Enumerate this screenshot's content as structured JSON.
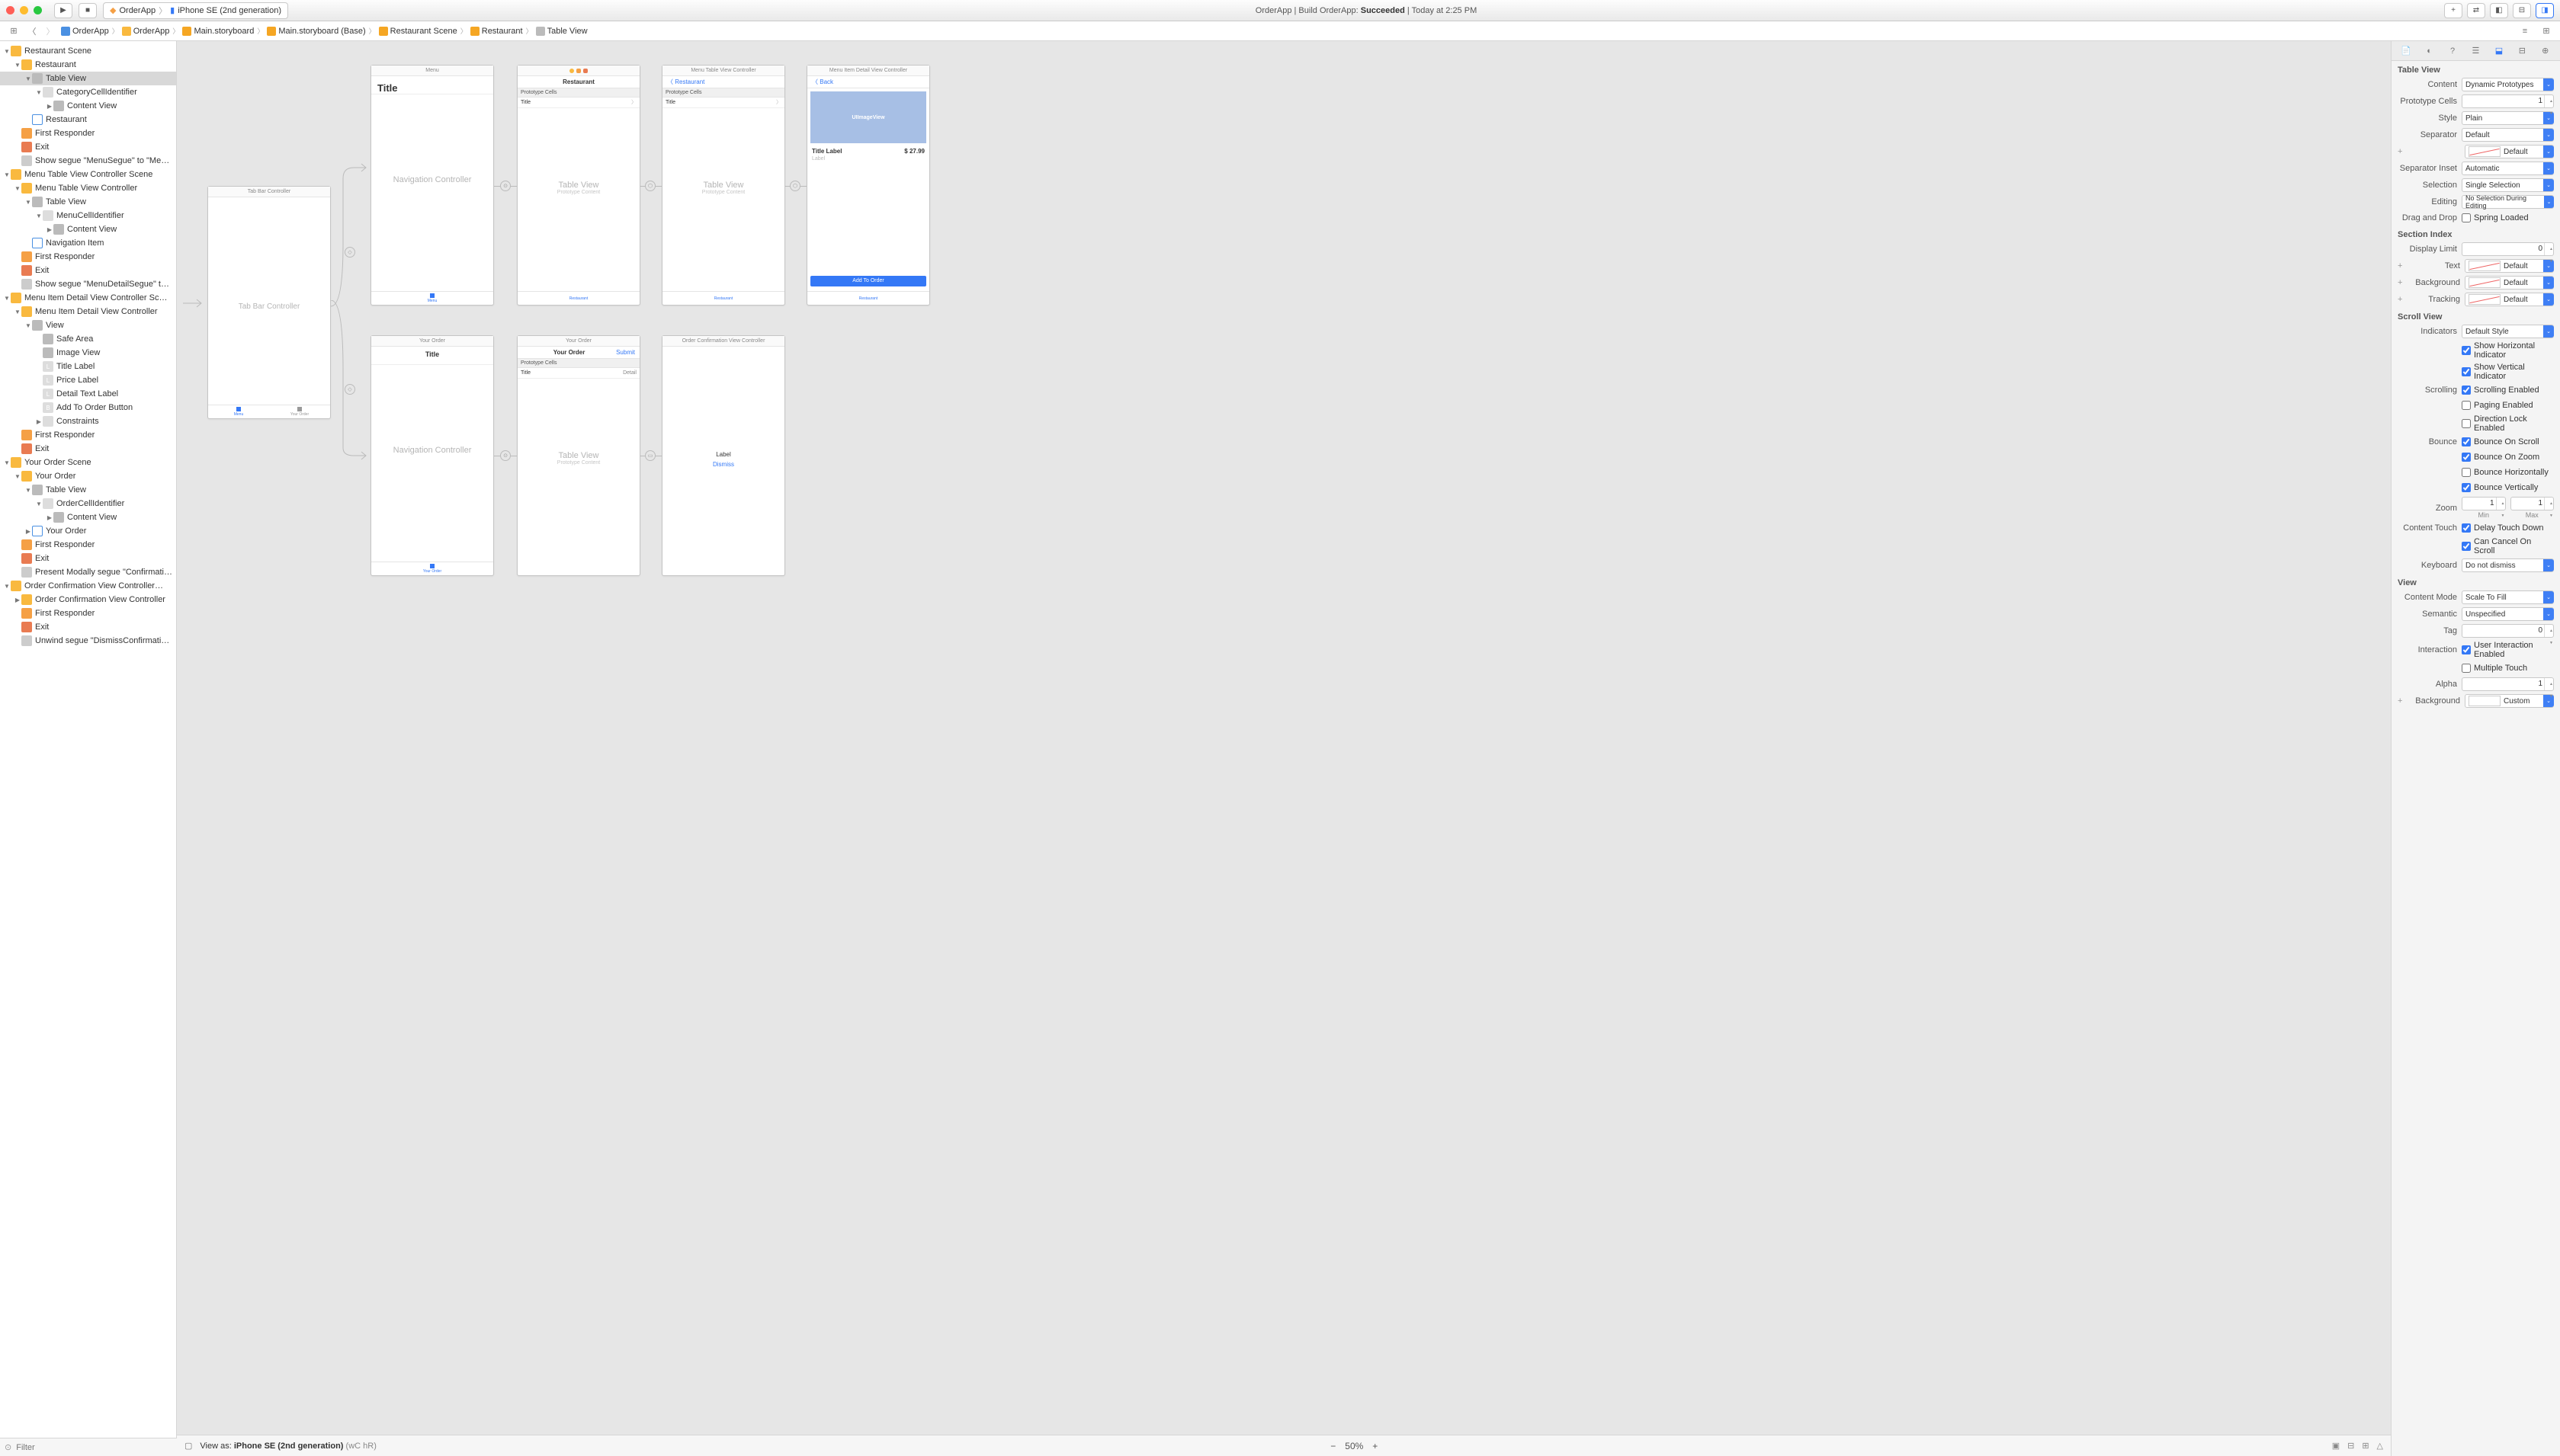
{
  "toolbar": {
    "scheme": "OrderApp",
    "device": "iPhone SE (2nd generation)",
    "status_prefix": "OrderApp | Build OrderApp:",
    "status_result": "Succeeded",
    "status_time": "Today at 2:25 PM"
  },
  "breadcrumb": [
    "OrderApp",
    "OrderApp",
    "Main.storyboard",
    "Main.storyboard (Base)",
    "Restaurant Scene",
    "Restaurant",
    "Table View"
  ],
  "outline": {
    "filter_placeholder": "Filter",
    "nodes": [
      {
        "d": 0,
        "t": "scene",
        "label": "Restaurant Scene",
        "open": true
      },
      {
        "d": 1,
        "t": "vc",
        "label": "Restaurant",
        "open": true
      },
      {
        "d": 2,
        "t": "view",
        "label": "Table View",
        "open": true,
        "sel": true
      },
      {
        "d": 3,
        "t": "cell",
        "label": "CategoryCellIdentifier",
        "open": true
      },
      {
        "d": 4,
        "t": "view",
        "label": "Content View",
        "open": false
      },
      {
        "d": 2,
        "t": "nav",
        "label": "Restaurant"
      },
      {
        "d": 1,
        "t": "fr",
        "label": "First Responder"
      },
      {
        "d": 1,
        "t": "exit",
        "label": "Exit"
      },
      {
        "d": 1,
        "t": "segue",
        "label": "Show segue \"MenuSegue\" to \"Me…"
      },
      {
        "d": 0,
        "t": "scene",
        "label": "Menu Table View Controller Scene",
        "open": true
      },
      {
        "d": 1,
        "t": "vc",
        "label": "Menu Table View Controller",
        "open": true
      },
      {
        "d": 2,
        "t": "view",
        "label": "Table View",
        "open": true
      },
      {
        "d": 3,
        "t": "cell",
        "label": "MenuCellIdentifier",
        "open": true
      },
      {
        "d": 4,
        "t": "view",
        "label": "Content View",
        "open": false
      },
      {
        "d": 2,
        "t": "nav",
        "label": "Navigation Item"
      },
      {
        "d": 1,
        "t": "fr",
        "label": "First Responder"
      },
      {
        "d": 1,
        "t": "exit",
        "label": "Exit"
      },
      {
        "d": 1,
        "t": "segue",
        "label": "Show segue \"MenuDetailSegue\" t…"
      },
      {
        "d": 0,
        "t": "scene",
        "label": "Menu Item Detail View Controller Sc…",
        "open": true
      },
      {
        "d": 1,
        "t": "vc",
        "label": "Menu Item Detail View Controller",
        "open": true
      },
      {
        "d": 2,
        "t": "view",
        "label": "View",
        "open": true
      },
      {
        "d": 3,
        "t": "view",
        "label": "Safe Area"
      },
      {
        "d": 3,
        "t": "view",
        "label": "Image View"
      },
      {
        "d": 3,
        "t": "label",
        "label": "Title Label"
      },
      {
        "d": 3,
        "t": "label",
        "label": "Price Label"
      },
      {
        "d": 3,
        "t": "label",
        "label": "Detail Text Label"
      },
      {
        "d": 3,
        "t": "btn",
        "label": "Add To Order Button"
      },
      {
        "d": 3,
        "t": "cell",
        "label": "Constraints",
        "open": false
      },
      {
        "d": 1,
        "t": "fr",
        "label": "First Responder"
      },
      {
        "d": 1,
        "t": "exit",
        "label": "Exit"
      },
      {
        "d": 0,
        "t": "scene",
        "label": "Your Order Scene",
        "open": true
      },
      {
        "d": 1,
        "t": "vc",
        "label": "Your Order",
        "open": true
      },
      {
        "d": 2,
        "t": "view",
        "label": "Table View",
        "open": true
      },
      {
        "d": 3,
        "t": "cell",
        "label": "OrderCellIdentifier",
        "open": true
      },
      {
        "d": 4,
        "t": "view",
        "label": "Content View",
        "open": false
      },
      {
        "d": 2,
        "t": "nav",
        "label": "Your Order",
        "open": false
      },
      {
        "d": 1,
        "t": "fr",
        "label": "First Responder"
      },
      {
        "d": 1,
        "t": "exit",
        "label": "Exit"
      },
      {
        "d": 1,
        "t": "segue",
        "label": "Present Modally segue \"Confirmati…"
      },
      {
        "d": 0,
        "t": "scene",
        "label": "Order Confirmation View Controller…",
        "open": true
      },
      {
        "d": 1,
        "t": "vc",
        "label": "Order Confirmation View Controller",
        "open": false
      },
      {
        "d": 1,
        "t": "fr",
        "label": "First Responder"
      },
      {
        "d": 1,
        "t": "exit",
        "label": "Exit"
      },
      {
        "d": 1,
        "t": "segue",
        "label": "Unwind segue \"DismissConfirmati…"
      }
    ]
  },
  "canvas": {
    "view_as_prefix": "View as:",
    "view_as_device": "iPhone SE (2nd generation)",
    "view_as_suffix": "(wC hR)",
    "zoom": "50%",
    "scenes": {
      "tabbar": {
        "hdr": "Tab Bar Controller",
        "body": "Tab Bar Controller",
        "tabs": [
          {
            "label": "Menu",
            "on": true
          },
          {
            "label": "Your Order",
            "on": false
          }
        ]
      },
      "nav_menu": {
        "hdr": "Menu",
        "body": "Navigation Controller",
        "title": "Title",
        "tabs": [
          {
            "label": "Menu",
            "on": true
          }
        ]
      },
      "nav_order": {
        "hdr": "Your Order",
        "body": "Navigation Controller",
        "title": "Title",
        "tabs": [
          {
            "label": "Your Order",
            "on": true
          }
        ]
      },
      "restaurant": {
        "hdr": "",
        "nav": "Restaurant",
        "sec": "Prototype Cells",
        "cell": "Title",
        "body": "Table View",
        "sub": "Prototype Content",
        "tabs": [
          {
            "label": "Restaurant",
            "on": true
          }
        ]
      },
      "menu": {
        "hdr": "Menu Table View Controller",
        "back": "Restaurant",
        "sec": "Prototype Cells",
        "cell": "Title",
        "body": "Table View",
        "sub": "Prototype Content",
        "tabs": [
          {
            "label": "Restaurant",
            "on": true
          }
        ]
      },
      "detail": {
        "hdr": "Menu Item Detail View Controller",
        "back": "Back",
        "img": "UIImageView",
        "title": "Title Label",
        "price": "$ 27.99",
        "label": "Label",
        "add": "Add To Order",
        "tabs": [
          {
            "label": "Restaurant",
            "on": true
          }
        ]
      },
      "your_order": {
        "hdr": "Your Order",
        "nav": "Your Order",
        "action": "Submit",
        "sec": "Prototype Cells",
        "cell": "Title",
        "detail": "Detail",
        "body": "Table View",
        "sub": "Prototype Content"
      },
      "confirm": {
        "hdr": "Order Confirmation View Controller",
        "label": "Label",
        "dismiss": "Dismiss"
      }
    }
  },
  "inspector": {
    "tableview": {
      "header": "Table View",
      "content_lbl": "Content",
      "content": "Dynamic Prototypes",
      "proto_lbl": "Prototype Cells",
      "proto": "1",
      "style_lbl": "Style",
      "style": "Plain",
      "sep_lbl": "Separator",
      "sep": "Default",
      "sep_color": "Default",
      "inset_lbl": "Separator Inset",
      "inset": "Automatic",
      "selection_lbl": "Selection",
      "selection": "Single Selection",
      "editing_lbl": "Editing",
      "editing": "No Selection During Editing",
      "dnd_lbl": "Drag and Drop",
      "dnd": "Spring Loaded",
      "section_hdr": "Section Index",
      "limit_lbl": "Display Limit",
      "limit": "0",
      "text_lbl": "Text",
      "text": "Default",
      "bg_lbl": "Background",
      "bg": "Default",
      "track_lbl": "Tracking",
      "track": "Default"
    },
    "scroll": {
      "header": "Scroll View",
      "ind_lbl": "Indicators",
      "ind": "Default Style",
      "show_h": "Show Horizontal Indicator",
      "show_v": "Show Vertical Indicator",
      "scroll_lbl": "Scrolling",
      "scroll_en": "Scrolling Enabled",
      "paging": "Paging Enabled",
      "dirlock": "Direction Lock Enabled",
      "bounce_lbl": "Bounce",
      "b_scroll": "Bounce On Scroll",
      "b_zoom": "Bounce On Zoom",
      "b_h": "Bounce Horizontally",
      "b_v": "Bounce Vertically",
      "zoom_lbl": "Zoom",
      "zoom_min": "1",
      "zoom_max": "1",
      "min": "Min",
      "max": "Max",
      "touch_lbl": "Content Touch",
      "delay": "Delay Touch Down",
      "cancel": "Can Cancel On Scroll",
      "kb_lbl": "Keyboard",
      "kb": "Do not dismiss"
    },
    "view": {
      "header": "View",
      "mode_lbl": "Content Mode",
      "mode": "Scale To Fill",
      "sem_lbl": "Semantic",
      "sem": "Unspecified",
      "tag_lbl": "Tag",
      "tag": "0",
      "inter_lbl": "Interaction",
      "inter": "User Interaction Enabled",
      "multi": "Multiple Touch",
      "alpha_lbl": "Alpha",
      "alpha": "1",
      "bg_lbl": "Background",
      "bg": "Custom"
    }
  }
}
